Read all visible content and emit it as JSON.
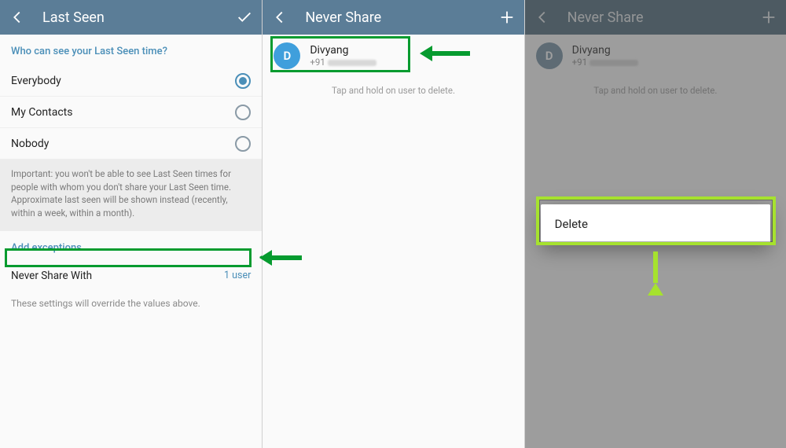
{
  "panel1": {
    "header": {
      "title": "Last Seen"
    },
    "section_who": "Who can see your Last Seen time?",
    "options": {
      "everybody": "Everybody",
      "my_contacts": "My Contacts",
      "nobody": "Nobody",
      "selected": "everybody"
    },
    "important_note": "Important: you won't be able to see Last Seen times for people with whom you don't share your Last Seen time. Approximate last seen will be shown instead (recently, within a week, within a month).",
    "section_exceptions": "Add exceptions",
    "never_share_label": "Never Share With",
    "never_share_count": "1 user",
    "override_hint": "These settings will override the values above."
  },
  "panel2": {
    "header": {
      "title": "Never Share"
    },
    "contact": {
      "initial": "D",
      "name": "Divyang",
      "phone_prefix": "+91"
    },
    "helper": "Tap and hold on user to delete."
  },
  "panel3": {
    "header": {
      "title": "Never Share"
    },
    "contact": {
      "initial": "D",
      "name": "Divyang",
      "phone_prefix": "+91"
    },
    "helper": "Tap and hold on user to delete.",
    "dialog": {
      "delete": "Delete"
    }
  },
  "annotations": {
    "highlight_color_green": "#069b2f",
    "highlight_color_lime": "#a6e22e"
  }
}
